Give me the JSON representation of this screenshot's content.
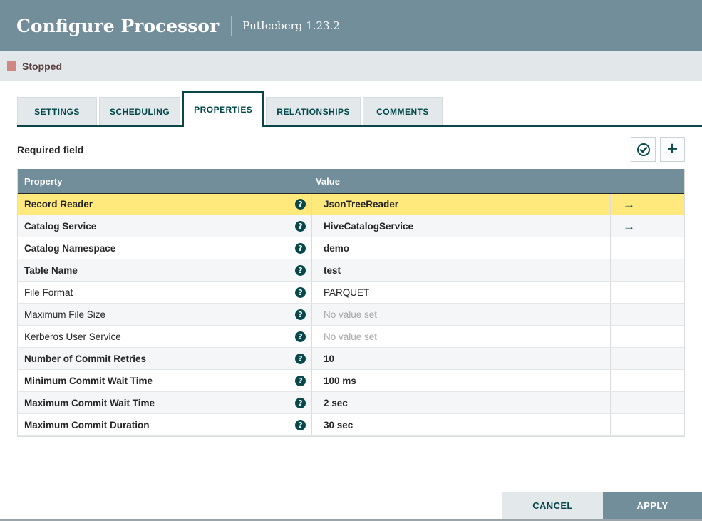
{
  "dialog": {
    "title": "Configure Processor",
    "subtitle": "PutIceberg 1.23.2"
  },
  "status": {
    "label": "Stopped",
    "icon": "stopped-square-icon",
    "icon_color": "#d08683"
  },
  "tabs": [
    {
      "label": "SETTINGS",
      "active": false
    },
    {
      "label": "SCHEDULING",
      "active": false
    },
    {
      "label": "PROPERTIES",
      "active": true
    },
    {
      "label": "RELATIONSHIPS",
      "active": false
    },
    {
      "label": "COMMENTS",
      "active": false
    }
  ],
  "properties_panel": {
    "required_field_label": "Required field",
    "buttons": [
      {
        "name": "verify-properties-button",
        "icon": "check-circle-icon"
      },
      {
        "name": "add-property-button",
        "icon": "plus-icon"
      }
    ],
    "table": {
      "columns": [
        "Property",
        "Value",
        ""
      ],
      "help_icon": "question-icon",
      "goto_icon": "right-arrow-icon",
      "rows": [
        {
          "property": "Record Reader",
          "value": "JsonTreeReader",
          "required": true,
          "selected": true,
          "unset": false,
          "has_goto": true
        },
        {
          "property": "Catalog Service",
          "value": "HiveCatalogService",
          "required": true,
          "selected": false,
          "unset": false,
          "has_goto": true
        },
        {
          "property": "Catalog Namespace",
          "value": "demo",
          "required": true,
          "selected": false,
          "unset": false,
          "has_goto": false
        },
        {
          "property": "Table Name",
          "value": "test",
          "required": true,
          "selected": false,
          "unset": false,
          "has_goto": false
        },
        {
          "property": "File Format",
          "value": "PARQUET",
          "required": false,
          "selected": false,
          "unset": false,
          "has_goto": false
        },
        {
          "property": "Maximum File Size",
          "value": "No value set",
          "required": false,
          "selected": false,
          "unset": true,
          "has_goto": false
        },
        {
          "property": "Kerberos User Service",
          "value": "No value set",
          "required": false,
          "selected": false,
          "unset": true,
          "has_goto": false
        },
        {
          "property": "Number of Commit Retries",
          "value": "10",
          "required": true,
          "selected": false,
          "unset": false,
          "has_goto": false
        },
        {
          "property": "Minimum Commit Wait Time",
          "value": "100 ms",
          "required": true,
          "selected": false,
          "unset": false,
          "has_goto": false
        },
        {
          "property": "Maximum Commit Wait Time",
          "value": "2 sec",
          "required": true,
          "selected": false,
          "unset": false,
          "has_goto": false
        },
        {
          "property": "Maximum Commit Duration",
          "value": "30 sec",
          "required": true,
          "selected": false,
          "unset": false,
          "has_goto": false
        }
      ]
    }
  },
  "footer": {
    "cancel_label": "CANCEL",
    "apply_label": "APPLY"
  },
  "colors": {
    "header_bg": "#728e9b",
    "status_bar_bg": "#e2e7ea",
    "accent_teal": "#004849",
    "selected_row_bg": "#ffe97d",
    "alt_row_bg": "#f4f6f7",
    "table_header_bg": "#728e9b",
    "unset_text": "#a8a8a8",
    "cancel_btn_bg": "#e3e8eb",
    "apply_btn_bg": "#728e9b"
  }
}
